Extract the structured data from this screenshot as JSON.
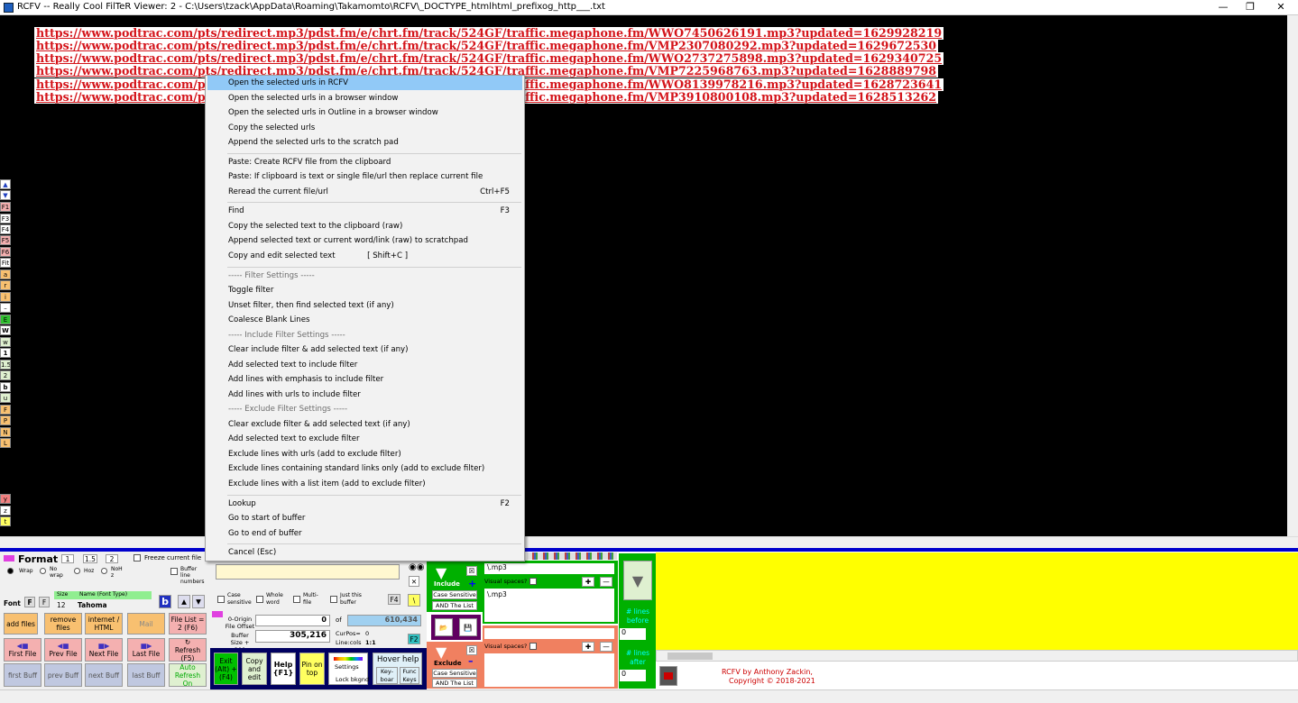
{
  "window": {
    "title": "RCFV -- Really Cool FilTeR Viewer: 2 - C:\\Users\\tzack\\AppData\\Roaming\\Takamomto\\RCFV\\_DOCTYPE_htmlhtml_prefixog_http___.txt",
    "minimize_icon": "minimize-icon",
    "maximize_icon": "restore-icon",
    "close_icon": "close-icon"
  },
  "content_lines": [
    "https://www.podtrac.com/pts/redirect.mp3/pdst.fm/e/chrt.fm/track/524GF/traffic.megaphone.fm/WWO7450626191.mp3?updated=1629928219",
    "https://www.podtrac.com/pts/redirect.mp3/pdst.fm/e/chrt.fm/track/524GF/traffic.megaphone.fm/VMP2307080292.mp3?updated=1629672530",
    "https://www.podtrac.com/pts/redirect.mp3/pdst.fm/e/chrt.fm/track/524GF/traffic.megaphone.fm/WWO2737275898.mp3?updated=1629340725",
    "https://www.podtrac.com/pts/redirect.mp3/pdst.fm/e/chrt.fm/track/524GF/traffic.megaphone.fm/VMP7225968763.mp3?updated=1628889798",
    "https://www.podtrac.com/pts/redirect.mp3/pdst.fm/e/chrt.fm/track/524GF/traffic.megaphone.fm/WWO8139978216.mp3?updated=1628723641",
    "https://www.podtrac.com/pts/redirect.mp3/pdst.fm/e/chrt.fm/track/524GF/traffic.megaphone.fm/VMP3910800108.mp3?updated=1628513262"
  ],
  "side_buttons": [
    "F1",
    "F3",
    "F4",
    "F5",
    "F6",
    "Fit",
    "a",
    "r",
    "i",
    "–",
    "E",
    "W",
    "w",
    "1",
    "1.5",
    "2",
    "b",
    "u",
    "F",
    "P",
    "N",
    "L"
  ],
  "side_buttons_bottom": [
    "y",
    "z",
    "t"
  ],
  "context_menu": {
    "items": [
      {
        "label": "Open  the selected urls in RCFV",
        "shortcut": ""
      },
      {
        "label": "Open  the selected urls in a browser window",
        "shortcut": ""
      },
      {
        "label": "Open  the selected urls in Outline in a browser window",
        "shortcut": ""
      },
      {
        "label": "Copy  the selected urls",
        "shortcut": ""
      },
      {
        "label": "Append  the selected urls to the scratch pad",
        "shortcut": ""
      },
      {
        "label": "Paste: Create RCFV file from the clipboard",
        "shortcut": ""
      },
      {
        "label": "Paste: If clipboard is text or single file/url then replace current file",
        "shortcut": ""
      },
      {
        "label": "Reread the current file/url",
        "shortcut": "Ctrl+F5"
      },
      {
        "label": "Find",
        "shortcut": "F3"
      },
      {
        "label": "Copy the selected text to the clipboard (raw)",
        "shortcut": ""
      },
      {
        "label": "Append selected text or current word/link (raw) to scratchpad",
        "shortcut": ""
      },
      {
        "label": "Copy and edit selected text             [ Shift+C ]",
        "shortcut": ""
      },
      {
        "label": "----- Filter Settings -----",
        "shortcut": ""
      },
      {
        "label": "Toggle filter",
        "shortcut": ""
      },
      {
        "label": "Unset filter, then find selected text (if any)",
        "shortcut": ""
      },
      {
        "label": "Coalesce Blank Lines",
        "shortcut": ""
      },
      {
        "label": "----- Include Filter Settings -----",
        "shortcut": ""
      },
      {
        "label": "Clear include filter & add selected text (if any)",
        "shortcut": ""
      },
      {
        "label": "Add selected text to include filter",
        "shortcut": ""
      },
      {
        "label": "Add lines with emphasis to include filter",
        "shortcut": ""
      },
      {
        "label": "Add lines with urls to include filter",
        "shortcut": ""
      },
      {
        "label": "----- Exclude Filter Settings -----",
        "shortcut": ""
      },
      {
        "label": "Clear exclude filter & add selected text (if any)",
        "shortcut": ""
      },
      {
        "label": "Add selected text to exclude filter",
        "shortcut": ""
      },
      {
        "label": "Exclude lines with urls (add to exclude filter)",
        "shortcut": ""
      },
      {
        "label": "Exclude lines containing standard links only (add to exclude filter)",
        "shortcut": ""
      },
      {
        "label": "Exclude lines with a list item (add to exclude filter)",
        "shortcut": ""
      },
      {
        "label": "Lookup",
        "shortcut": "F2"
      },
      {
        "label": "Go to start of buffer",
        "shortcut": ""
      },
      {
        "label": "Go to end of buffer",
        "shortcut": ""
      },
      {
        "label": "Cancel (Esc)",
        "shortcut": ""
      }
    ]
  },
  "format_panel": {
    "title": "Format",
    "tab1": "1",
    "tab15": "1.5",
    "tab2": "2",
    "freeze": "Freeze current file",
    "wrap": "Wrap",
    "no_wrap": "No wrap",
    "hoz": "Hoz",
    "no_hoz": "NoH z",
    "buffer_line_numbers": "Buffer line numbers",
    "font_label": "Font",
    "size_label": "Size",
    "name_label": "Name (Font Type)",
    "size_value": "12",
    "font_value": "Tahoma",
    "bold_label": "b",
    "add_files": "add files",
    "remove_files": "remove files",
    "internet_html": "internet / HTML",
    "mail": "Mail",
    "file_list": "File List = 2 (F6)",
    "first_file": "First File",
    "prev_file": "Prev File",
    "next_file": "Next File",
    "last_file": "Last File",
    "refresh": "Refresh (F5)",
    "first_buff": "first Buff",
    "prev_buff": "prev Buff",
    "next_buff": "next Buff",
    "last_buff": "last Buff",
    "auto_refresh": "Auto Refresh On"
  },
  "search_panel": {
    "case_sensitive": "Case sensitive",
    "whole_word": "Whole word",
    "multi_file": "Multi-file",
    "just_this_buffer": "Just this buffer",
    "f4": "F4",
    "backslash": "\\",
    "origin_label": "0-Origin File Offset",
    "origin_value": "0",
    "of_label": "of",
    "total_value": "610,434",
    "buffer_label": "Buffer Size + 200",
    "buffer_value": "305,216",
    "curpos_label": "CurPos=",
    "curpos_value": "0",
    "linecols_label": "Line:cols",
    "linecols_value": "1:1",
    "f2": "F2",
    "exit": "Exit (Alt) + (F4)",
    "copy_edit": "Copy and edit",
    "help": "Help {F1}",
    "pin": "Pin on top",
    "settings": "Settings",
    "lock_bkgnd": "Lock bkgnd",
    "hover_help": "Hover help",
    "keyboard": "Key-boar",
    "func_keys": "Func Keys"
  },
  "filter_panel": {
    "include_label": "Include",
    "include_plus": "+",
    "include_case": "Case Sensitive",
    "include_and": "AND The List",
    "include_pattern": "\\.mp3",
    "include_visual": "Visual spaces?",
    "include_text": "\\.mp3",
    "exclude_label": "Exclude",
    "exclude_minus": "–",
    "exclude_case": "Case Sensitive",
    "exclude_and": "AND The List",
    "exclude_visual": "Visual spaces?",
    "lines_before": "# lines before",
    "lines_before_value": "0",
    "lines_after": "# lines after",
    "lines_after_value": "0"
  },
  "credits": {
    "line1": "RCFV by Anthony Zackin,",
    "line2": "Copyright © 2018-2021"
  },
  "colors": {
    "background": "#000000",
    "url_color": "#d4141a",
    "filter_green": "#00b000",
    "yellow": "#ffff00",
    "menu_highlight": "#91c9f7"
  }
}
